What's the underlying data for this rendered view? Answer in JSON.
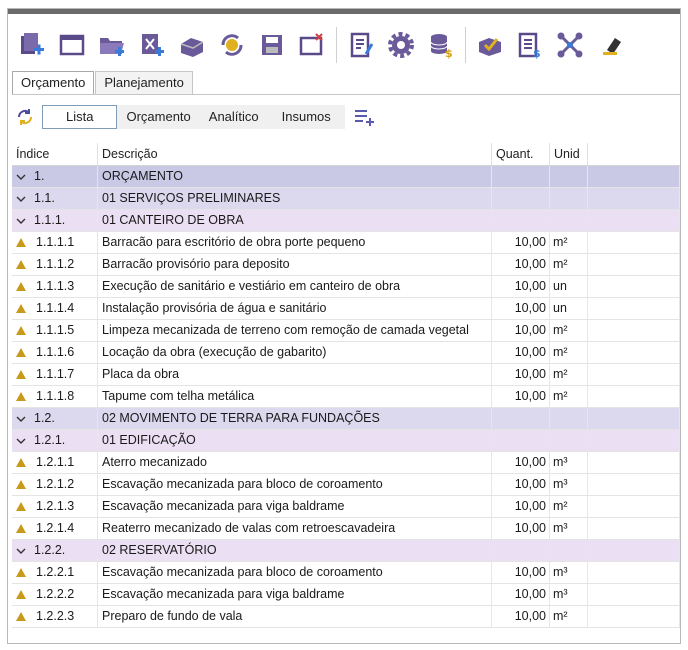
{
  "tabs": [
    {
      "label": "Orçamento",
      "active": true
    },
    {
      "label": "Planejamento",
      "active": false
    }
  ],
  "views": [
    {
      "label": "Lista",
      "active": true
    },
    {
      "label": "Orçamento",
      "active": false
    },
    {
      "label": "Analítico",
      "active": false
    },
    {
      "label": "Insumos",
      "active": false
    }
  ],
  "table": {
    "columns": {
      "index": "Índice",
      "desc": "Descrição",
      "qty": "Quant.",
      "unit": "Unid"
    },
    "rows": [
      {
        "level": "l1",
        "index": "1.",
        "desc": "ORÇAMENTO",
        "qty": "",
        "unit": ""
      },
      {
        "level": "l2",
        "index": "1.1.",
        "desc": "01 SERVIÇOS PRELIMINARES",
        "qty": "",
        "unit": ""
      },
      {
        "level": "l3",
        "index": "1.1.1.",
        "desc": "01 CANTEIRO DE OBRA",
        "qty": "",
        "unit": ""
      },
      {
        "level": "item",
        "index": "1.1.1.1",
        "desc": "Barracão para escritório de obra porte pequeno",
        "qty": "10,00",
        "unit": "m²"
      },
      {
        "level": "item",
        "index": "1.1.1.2",
        "desc": "Barracão provisório para deposito",
        "qty": "10,00",
        "unit": "m²"
      },
      {
        "level": "item",
        "index": "1.1.1.3",
        "desc": "Execução de sanitário e vestiário em canteiro de obra",
        "qty": "10,00",
        "unit": "un"
      },
      {
        "level": "item",
        "index": "1.1.1.4",
        "desc": "Instalação provisória de água e sanitário",
        "qty": "10,00",
        "unit": "un"
      },
      {
        "level": "item",
        "index": "1.1.1.5",
        "desc": "Limpeza mecanizada de terreno com remoção de camada vegetal",
        "qty": "10,00",
        "unit": "m²"
      },
      {
        "level": "item",
        "index": "1.1.1.6",
        "desc": "Locação da obra (execução de gabarito)",
        "qty": "10,00",
        "unit": "m²"
      },
      {
        "level": "item",
        "index": "1.1.1.7",
        "desc": "Placa da obra",
        "qty": "10,00",
        "unit": "m²"
      },
      {
        "level": "item",
        "index": "1.1.1.8",
        "desc": "Tapume com telha metálica",
        "qty": "10,00",
        "unit": "m²"
      },
      {
        "level": "l2",
        "index": "1.2.",
        "desc": "02 MOVIMENTO DE TERRA PARA FUNDAÇÕES",
        "qty": "",
        "unit": ""
      },
      {
        "level": "l3",
        "index": "1.2.1.",
        "desc": "01 EDIFICAÇÃO",
        "qty": "",
        "unit": ""
      },
      {
        "level": "item",
        "index": "1.2.1.1",
        "desc": "Aterro mecanizado",
        "qty": "10,00",
        "unit": "m³"
      },
      {
        "level": "item",
        "index": "1.2.1.2",
        "desc": "Escavação mecanizada para bloco de coroamento",
        "qty": "10,00",
        "unit": "m³"
      },
      {
        "level": "item",
        "index": "1.2.1.3",
        "desc": "Escavação mecanizada para viga baldrame",
        "qty": "10,00",
        "unit": "m²"
      },
      {
        "level": "item",
        "index": "1.2.1.4",
        "desc": "Reaterro mecanizado de valas com retroescavadeira",
        "qty": "10,00",
        "unit": "m³"
      },
      {
        "level": "l3",
        "index": "1.2.2.",
        "desc": "02 RESERVATÓRIO",
        "qty": "",
        "unit": ""
      },
      {
        "level": "item",
        "index": "1.2.2.1",
        "desc": "Escavação mecanizada para bloco de coroamento",
        "qty": "10,00",
        "unit": "m³"
      },
      {
        "level": "item",
        "index": "1.2.2.2",
        "desc": "Escavação mecanizada para viga baldrame",
        "qty": "10,00",
        "unit": "m³"
      },
      {
        "level": "item",
        "index": "1.2.2.3",
        "desc": "Preparo de fundo de vala",
        "qty": "10,00",
        "unit": "m²"
      }
    ]
  }
}
